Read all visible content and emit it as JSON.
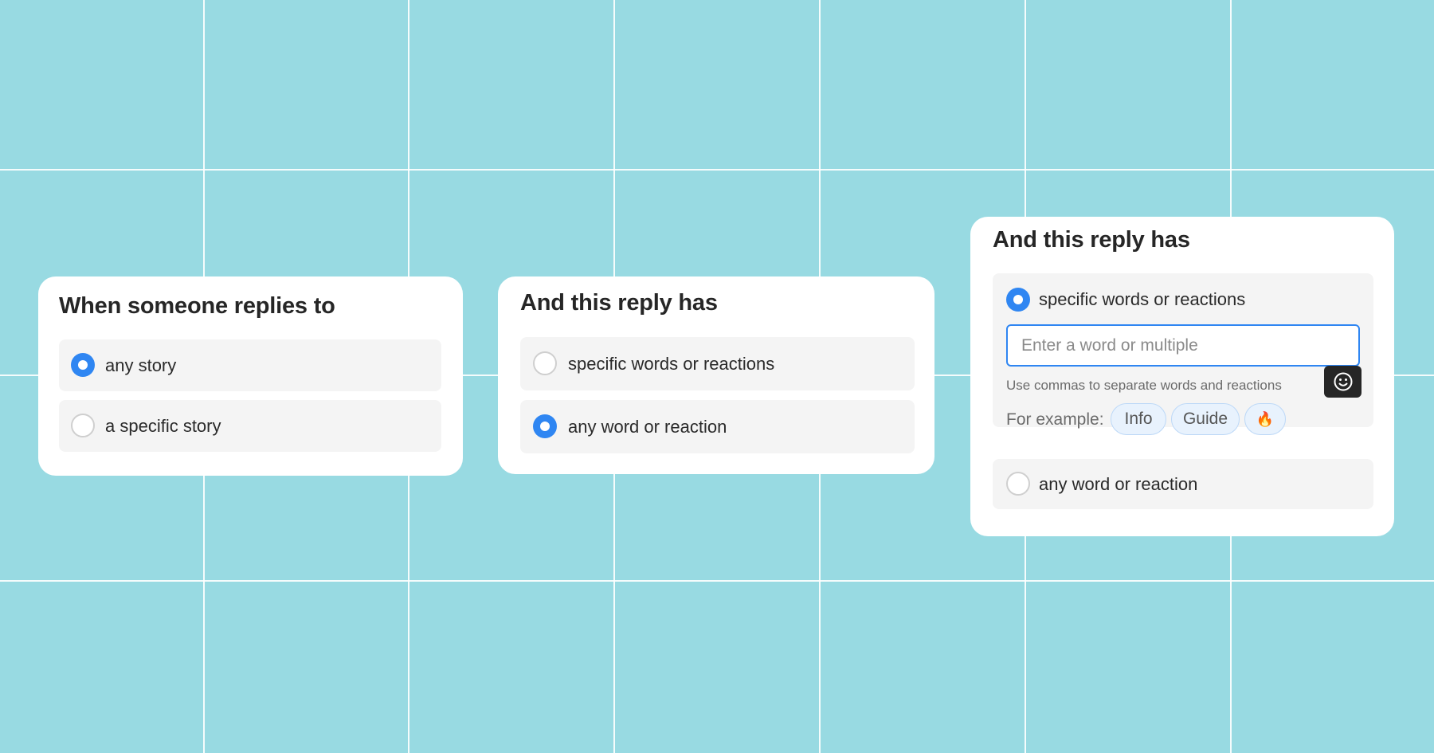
{
  "colors": {
    "background": "#98dae2",
    "accent": "#2f86f2",
    "card": "#ffffff",
    "option_bg": "#f4f4f4"
  },
  "card1": {
    "title": "When someone replies to",
    "options": [
      {
        "label": "any story",
        "selected": true
      },
      {
        "label": "a specific story",
        "selected": false
      }
    ]
  },
  "card2": {
    "title": "And this reply has",
    "options": [
      {
        "label": "specific words or reactions",
        "selected": false
      },
      {
        "label": "any word or reaction",
        "selected": true
      }
    ]
  },
  "card3": {
    "title": "And this reply has",
    "options": [
      {
        "label": "specific words or reactions",
        "selected": true
      },
      {
        "label": "any word or reaction",
        "selected": false
      }
    ],
    "input": {
      "value": "",
      "placeholder": "Enter a word or multiple"
    },
    "emoji_icon": "smiley-icon",
    "hint": "Use commas to separate words and reactions",
    "example_label": "For example:",
    "example_chips": [
      "Info",
      "Guide",
      "🔥"
    ]
  }
}
